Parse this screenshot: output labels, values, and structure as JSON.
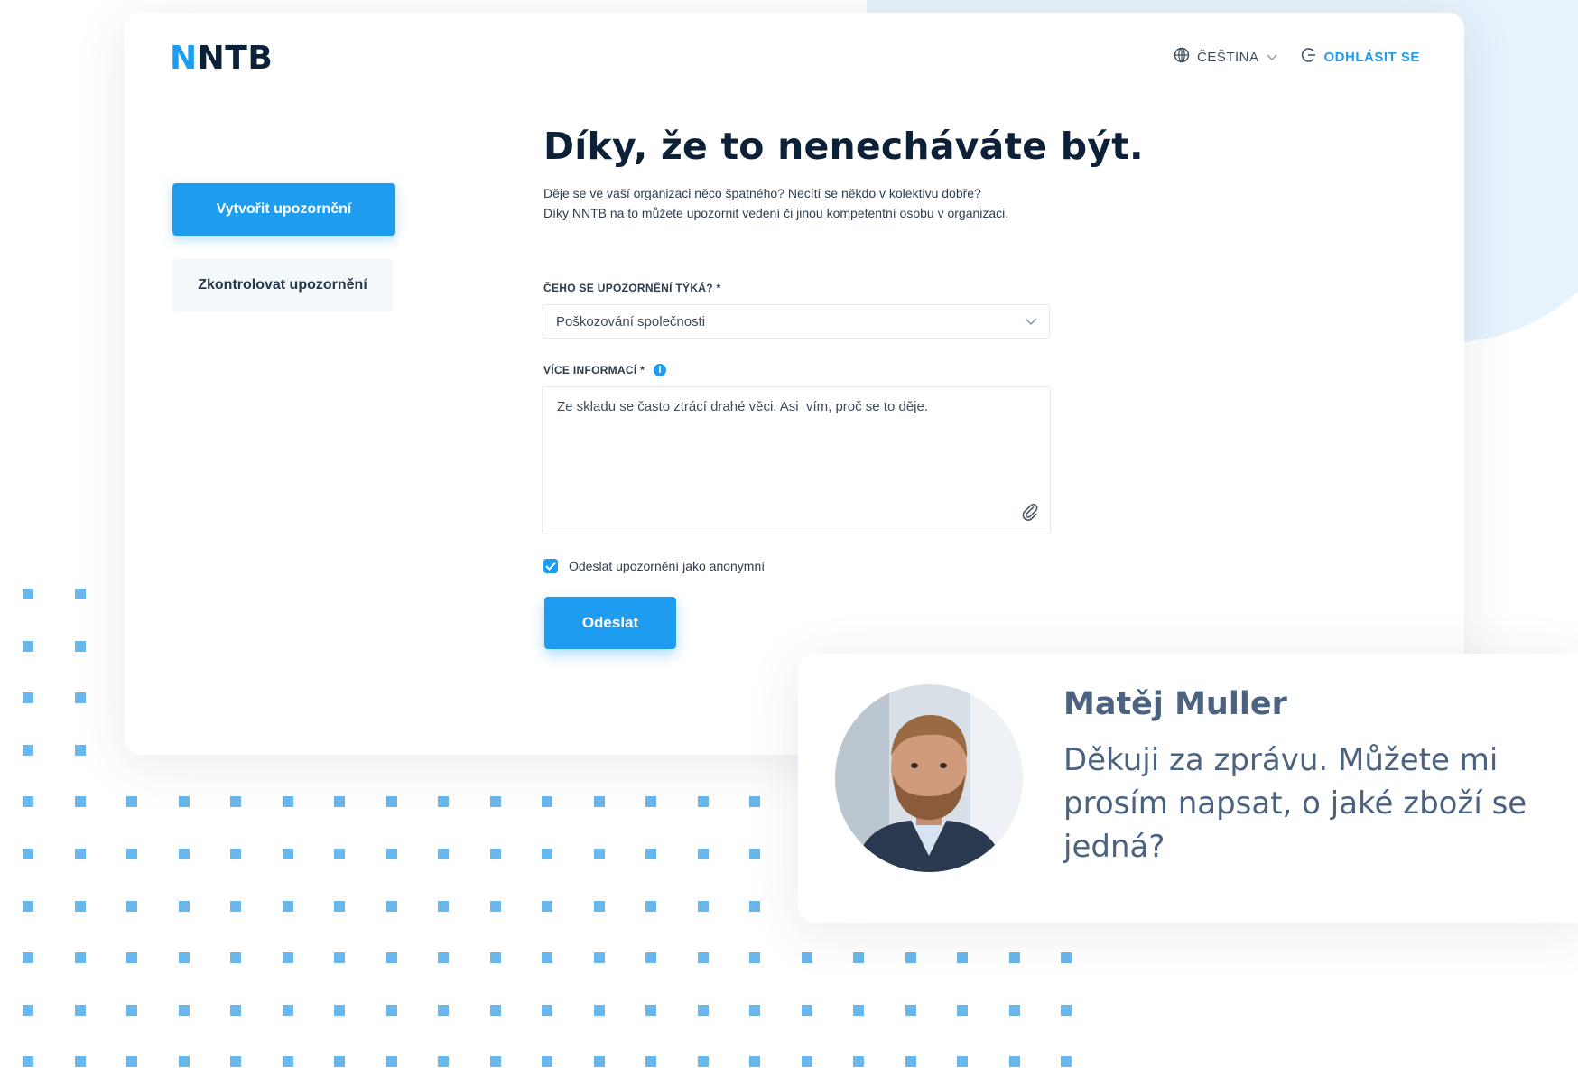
{
  "brand": {
    "logo_first": "N",
    "logo_rest": "NTB"
  },
  "topbar": {
    "language": "ČEŠTINA",
    "logout": "ODHLÁSIT SE"
  },
  "sidebar": {
    "create_label": "Vytvořit upozornění",
    "check_label": "Zkontrolovat upozornění"
  },
  "main": {
    "title": "Díky, že to nenecháváte být.",
    "intro_line1": "Děje se ve vaší organizaci něco špatného? Necítí se někdo v kolektivu dobře?",
    "intro_line2": "Díky NNTB na to můžete upozornit vedení či jinou kompetentní osobu v organizaci."
  },
  "form": {
    "topic_label": "ČEHO SE UPOZORNĚNÍ TÝKÁ? *",
    "topic_value": "Poškozování společnosti",
    "info_label": "VÍCE INFORMACÍ *",
    "info_value": "Ze skladu se často ztrácí drahé věci. Asi  vím, proč se to děje.",
    "anonymous_label": "Odeslat upozornění jako anonymní",
    "anonymous_checked": true,
    "submit_label": "Odeslat"
  },
  "chat": {
    "name": "Matěj Muller",
    "message": "Děkuji za zprávu. Můžete mi prosím napsat, o jaké zboží se jedná?"
  },
  "colors": {
    "accent": "#1e9cf0",
    "dark": "#0c2138",
    "chat_text": "#4b6380"
  }
}
